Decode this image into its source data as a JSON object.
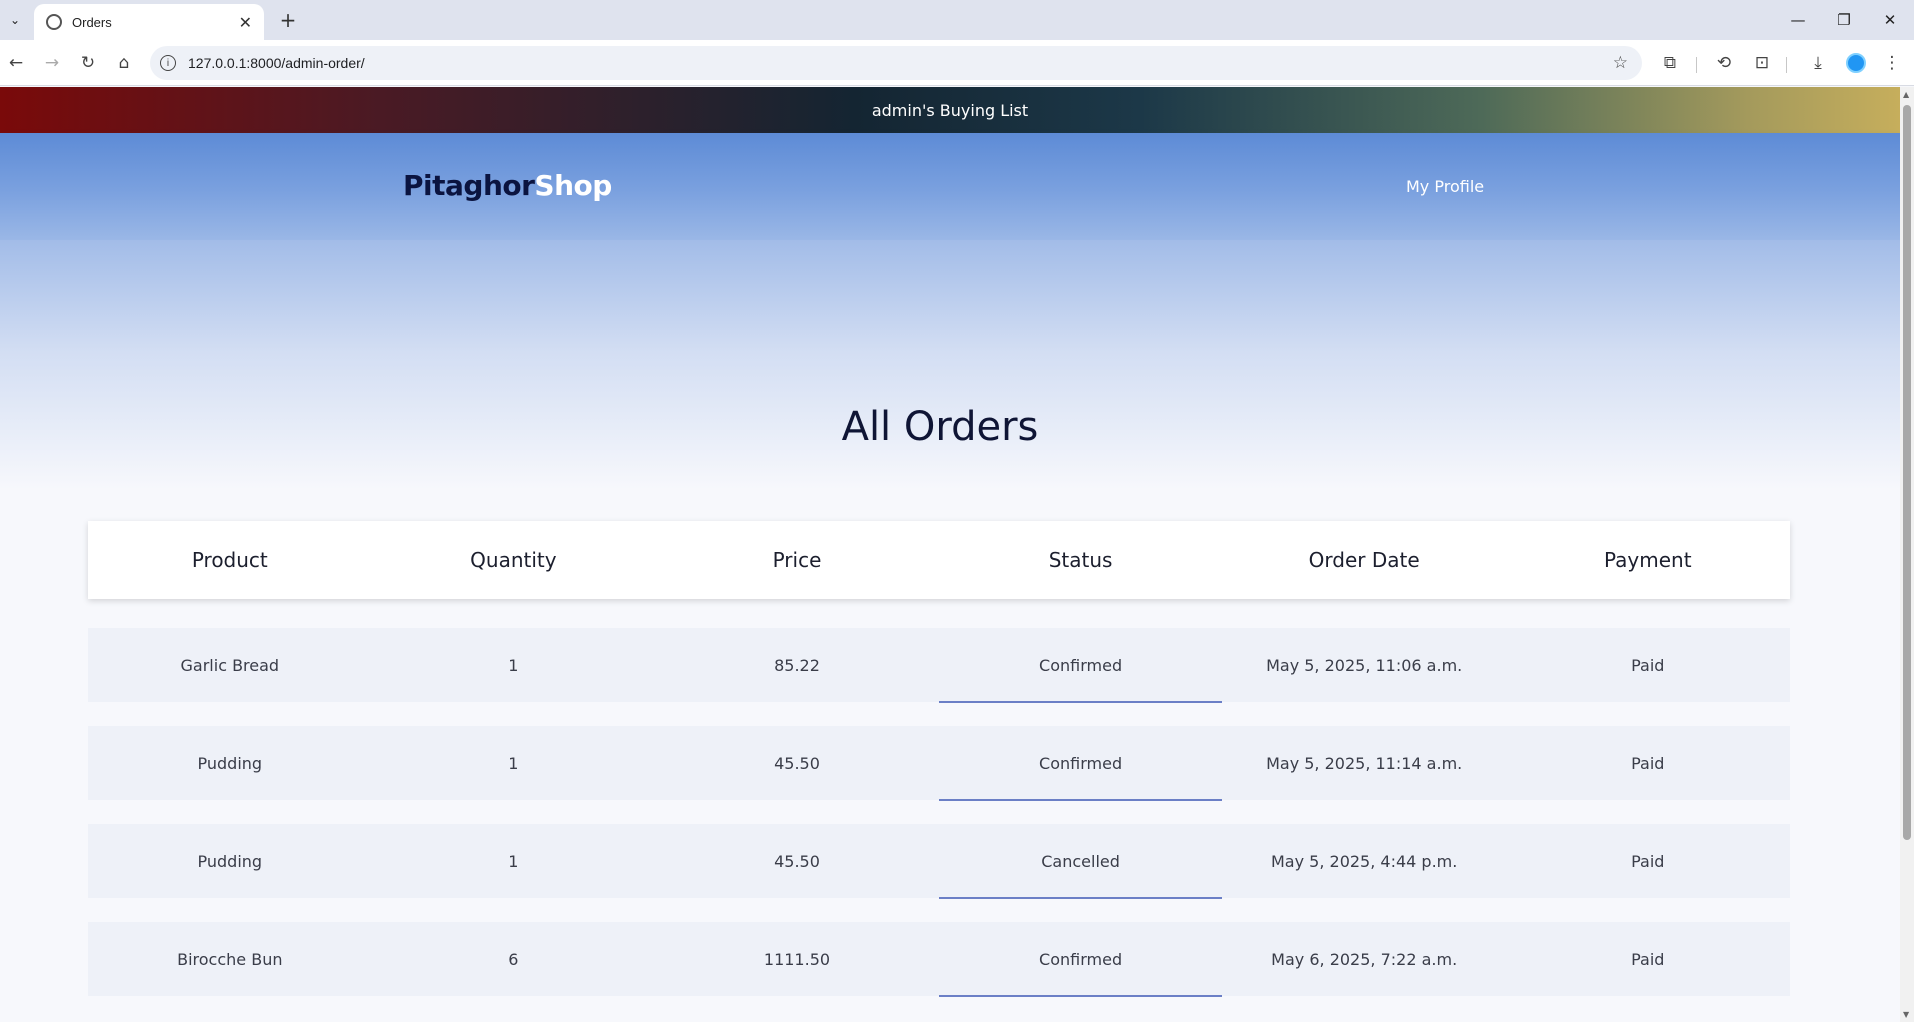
{
  "browser": {
    "tab_title": "Orders",
    "url": "127.0.0.1:8000/admin-order/"
  },
  "banner": {
    "text": "admin's Buying List"
  },
  "navbar": {
    "logo_part1": "Pitaghor",
    "logo_part2": "Shop",
    "profile_link": "My Profile"
  },
  "page": {
    "title": "All Orders"
  },
  "table": {
    "headers": [
      "Product",
      "Quantity",
      "Price",
      "Status",
      "Order Date",
      "Payment"
    ],
    "rows": [
      [
        "Garlic Bread",
        "1",
        "85.22",
        "Confirmed",
        "May 5, 2025, 11:06 a.m.",
        "Paid"
      ],
      [
        "Pudding",
        "1",
        "45.50",
        "Confirmed",
        "May 5, 2025, 11:14 a.m.",
        "Paid"
      ],
      [
        "Pudding",
        "1",
        "45.50",
        "Cancelled",
        "May 5, 2025, 4:44 p.m.",
        "Paid"
      ],
      [
        "Birocche Bun",
        "6",
        "1111.50",
        "Confirmed",
        "May 6, 2025, 7:22 a.m.",
        "Paid"
      ]
    ]
  }
}
